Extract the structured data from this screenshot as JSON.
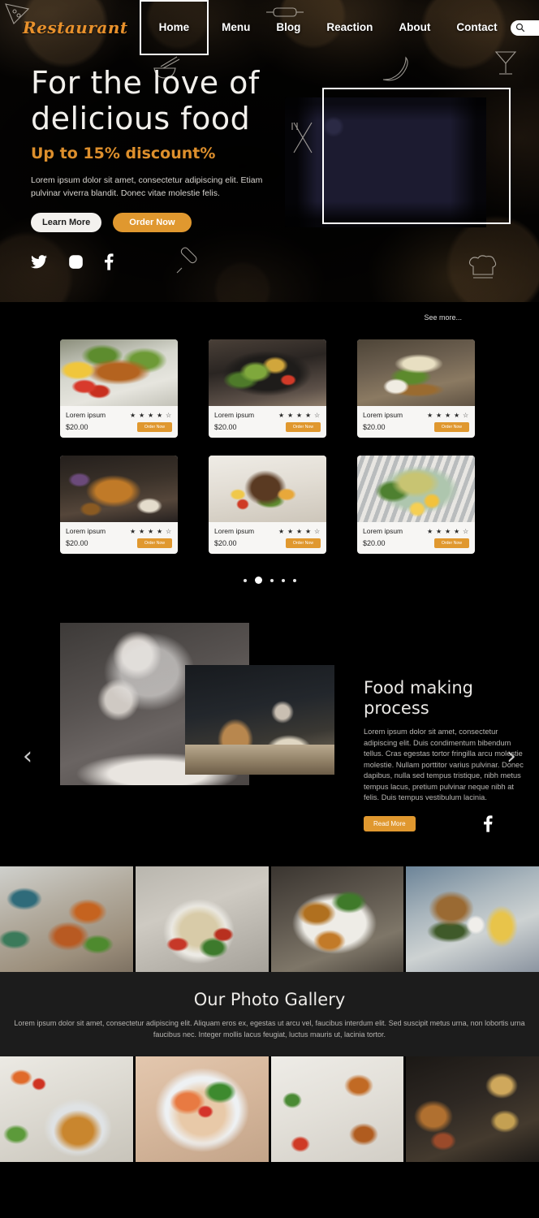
{
  "nav": {
    "logo": "Restaurant",
    "links": [
      {
        "label": "Home",
        "active": true
      },
      {
        "label": "Menu",
        "active": false
      },
      {
        "label": "Blog",
        "active": false
      },
      {
        "label": "Reaction",
        "active": false
      },
      {
        "label": "About",
        "active": false
      },
      {
        "label": "Contact",
        "active": false
      }
    ],
    "search": {
      "value": "",
      "placeholder": "",
      "icon": "search-icon"
    }
  },
  "hero": {
    "title_line1": "For the love of",
    "title_line2": "delicious food",
    "subtitle": "Up to 15% discount%",
    "paragraph": "Lorem ipsum dolor sit amet, consectetur adipiscing elit. Etiam pulvinar viverra blandit. Donec vitae molestie felis.",
    "primary_button": "Learn More",
    "secondary_button": "Order Now",
    "socials": [
      "twitter-icon",
      "instagram-icon",
      "facebook-icon"
    ],
    "image_alt": "french-toast-blueberries-banana"
  },
  "menu_section": {
    "see_more": "See more...",
    "prev_arrow": "‹",
    "next_arrow": "›",
    "order_label": "Order Now",
    "dots": [
      false,
      true,
      false,
      false,
      false
    ],
    "cards": [
      {
        "title": "Lorem ipsum",
        "price": "$20.00",
        "rating": "★ ★ ★ ★ ☆",
        "image": "grilled-salmon-salad"
      },
      {
        "title": "Lorem ipsum",
        "price": "$20.00",
        "rating": "★ ★ ★ ★ ☆",
        "image": "green-salad-bowl"
      },
      {
        "title": "Lorem ipsum",
        "price": "$20.00",
        "rating": "★ ★ ★ ★ ☆",
        "image": "chicken-sandwich-board"
      },
      {
        "title": "Lorem ipsum",
        "price": "$20.00",
        "rating": "★ ★ ★ ★ ☆",
        "image": "roast-chicken-feast"
      },
      {
        "title": "Lorem ipsum",
        "price": "$20.00",
        "rating": "★ ★ ★ ★ ☆",
        "image": "lamb-chops-plate"
      },
      {
        "title": "Lorem ipsum",
        "price": "$20.00",
        "rating": "★ ★ ★ ★ ☆",
        "image": "quinoa-egg-salad"
      }
    ]
  },
  "process": {
    "title_line1": "Food making",
    "title_line2": "process",
    "paragraph": "Lorem ipsum dolor sit amet, consectetur adipiscing elit. Duis condimentum bibendum tellus. Cras egestas tortor fringilla arcu molestie molestie. Nullam porttitor varius pulvinar. Donec dapibus, nulla sed tempus tristique, nibh metus tempus lacus, pretium pulvinar neque nibh at felis. Duis tempus vestibulum lacinia.",
    "button": "Read More",
    "social": "facebook-icon",
    "image_1_alt": "chef-clapping-flour",
    "image_2_alt": "chef-with-dough-bowl"
  },
  "strip_top": [
    {
      "alt": "loaded-fries-platter"
    },
    {
      "alt": "pasta-twirl-fork"
    },
    {
      "alt": "crispy-chicken-salad"
    },
    {
      "alt": "burger-and-fries"
    }
  ],
  "gallery": {
    "title": "Our Photo Gallery",
    "paragraph": "Lorem ipsum dolor sit amet, consectetur adipiscing elit. Aliquam eros ex, egestas ut arcu vel, faucibus interdum elit. Sed suscipit metus urna, non lobortis urna faucibus nec. Integer mollis lacus feugiat, luctus mauris ut, lacinia tortor.",
    "images": [
      {
        "alt": "veggie-grain-bowl"
      },
      {
        "alt": "shrimp-noodle-soup"
      },
      {
        "alt": "loaded-fries-flatlay"
      },
      {
        "alt": "fried-food-dark-table"
      }
    ]
  },
  "colors": {
    "accent": "#e0982f",
    "logo": "#e8912c",
    "background": "#000000",
    "card_bg": "#f7f6f4",
    "gallery_bg": "#1c1c1c"
  }
}
